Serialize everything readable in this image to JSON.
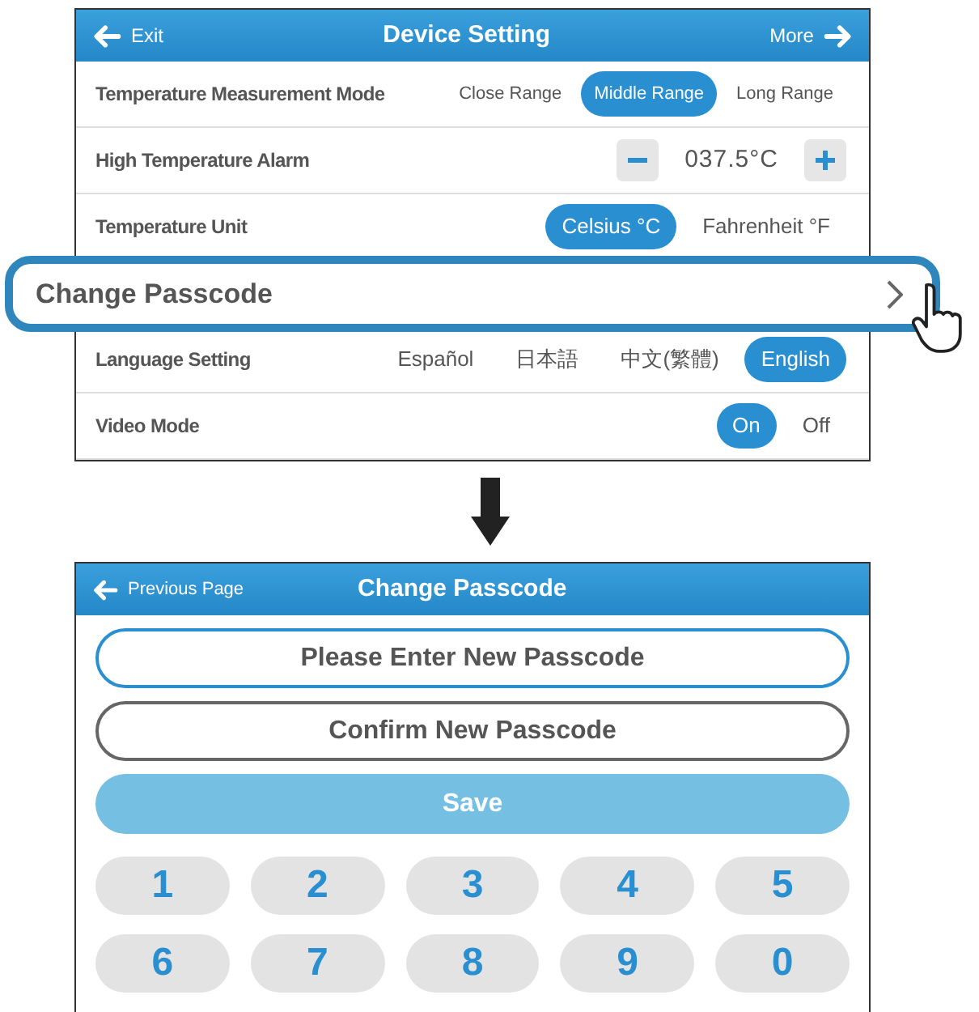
{
  "device_setting": {
    "back": "Exit",
    "title": "Device Setting",
    "more": "More",
    "rows": [
      {
        "kind": "options",
        "label": "Temperature Measurement Mode",
        "small": true,
        "options": [
          {
            "label": "Close Range",
            "selected": false
          },
          {
            "label": "Middle Range",
            "selected": true
          },
          {
            "label": "Long Range",
            "selected": false
          }
        ]
      },
      {
        "kind": "stepper",
        "label": "High Temperature Alarm",
        "value": "037.5°C"
      },
      {
        "kind": "options",
        "label": "Temperature Unit",
        "options": [
          {
            "label": "Celsius °C",
            "selected": true
          },
          {
            "label": "Fahrenheit °F",
            "selected": false
          }
        ]
      },
      {
        "kind": "link",
        "label": "Change Passcode",
        "highlighted": true
      },
      {
        "kind": "options",
        "label": "Language Setting",
        "options": [
          {
            "label": "Español",
            "selected": false
          },
          {
            "label": "日本語",
            "selected": false
          },
          {
            "label": "中文(繁體)",
            "selected": false
          },
          {
            "label": "English",
            "selected": true
          }
        ]
      },
      {
        "kind": "options",
        "label": "Video Mode",
        "options": [
          {
            "label": "On",
            "selected": true
          },
          {
            "label": "Off",
            "selected": false
          }
        ]
      }
    ]
  },
  "change_passcode": {
    "back": "Previous Page",
    "title": "Change Passcode",
    "fields": [
      {
        "placeholder": "Please Enter New Passcode",
        "focused": true
      },
      {
        "placeholder": "Confirm New Passcode",
        "focused": false
      }
    ],
    "save": "Save",
    "keys": [
      "1",
      "2",
      "3",
      "4",
      "5",
      "6",
      "7",
      "8",
      "9",
      "0"
    ]
  }
}
